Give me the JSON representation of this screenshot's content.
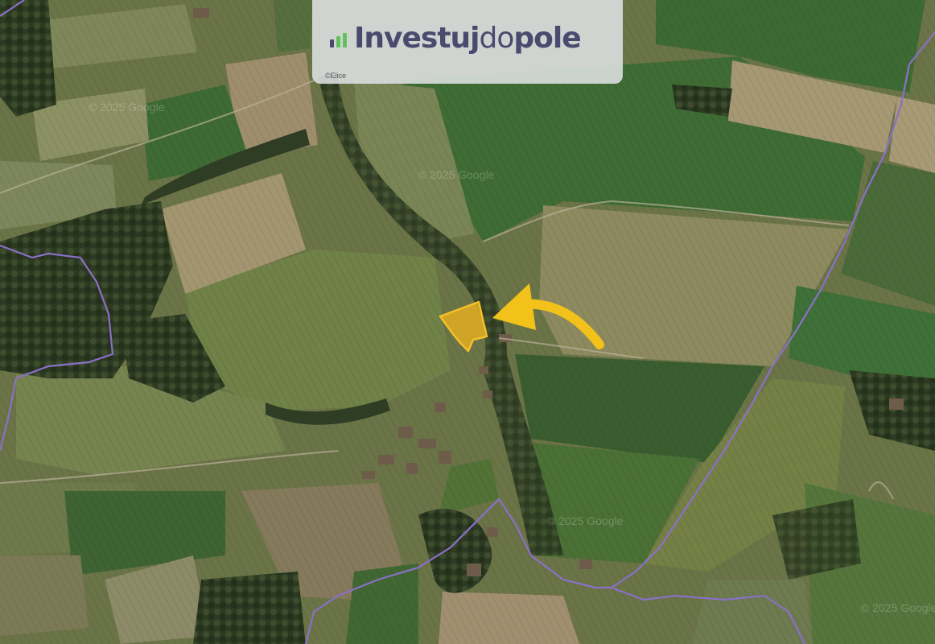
{
  "logo": {
    "part1": "Investuj",
    "part2": "do",
    "part3": "pole",
    "color_primary": "#4a4a6e",
    "color_accent": "#5fc25a"
  },
  "map_credit": "©Elice",
  "watermarks": [
    "© 2025 Google",
    "© 2025 Google",
    "© 2025 Google",
    "© 2025 Google"
  ],
  "colors": {
    "parcel_fill": "#f2b51c",
    "arrow": "#f2c21a",
    "boundary": "#8a70c8"
  },
  "icons": [
    "investujdopole-logo-icon",
    "arrow-pointer-icon"
  ]
}
